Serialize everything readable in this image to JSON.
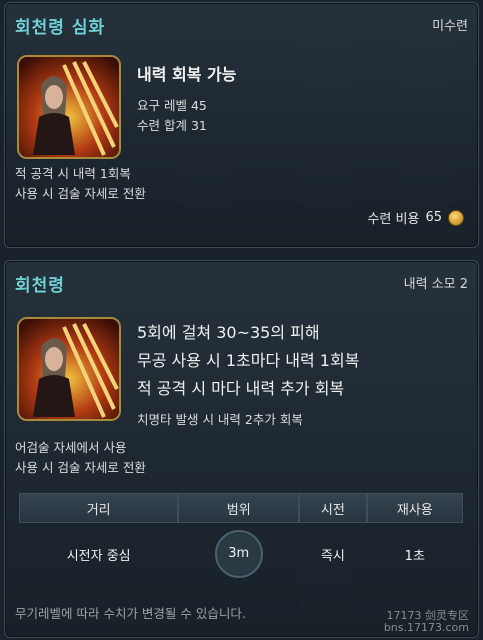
{
  "panel_top": {
    "title": "회천령 심화",
    "status": "미수련",
    "skill_name": "내력 회복 가능",
    "required_level": "요구 레벨 45",
    "training_total": "수련 합계 31",
    "desc_lines": [
      "적 공격 시 내력 1회복",
      "사용 시 검술 자세로 전환"
    ],
    "cost_label": "수련 비용",
    "cost_value": "65"
  },
  "panel_bottom": {
    "title": "회천령",
    "resource": "내력 소모 2",
    "effects": [
      "5회에 걸쳐 30~35의 피해",
      "무공 사용 시 1초마다 내력 1회복",
      "적 공격 시 마다 내력 추가 회복"
    ],
    "crit_line": "치명타 발생 시 내력 2추가 회복",
    "desc_lines": [
      "어검술 자세에서 사용",
      "사용 시 검술 자세로 전환"
    ],
    "stats": {
      "headers": [
        "거리",
        "범위",
        "시전",
        "재사용"
      ],
      "values": [
        "시전자 중심",
        "3m",
        "즉시",
        "1초"
      ]
    },
    "footer": "무기레벨에 따라 수치가 변경될 수 있습니다."
  },
  "watermark": {
    "line1": "17173 剑灵专区",
    "line2": "bns.17173.com"
  },
  "colors": {
    "title": "#6fd0d6",
    "icon_border": "#a78a3b"
  }
}
